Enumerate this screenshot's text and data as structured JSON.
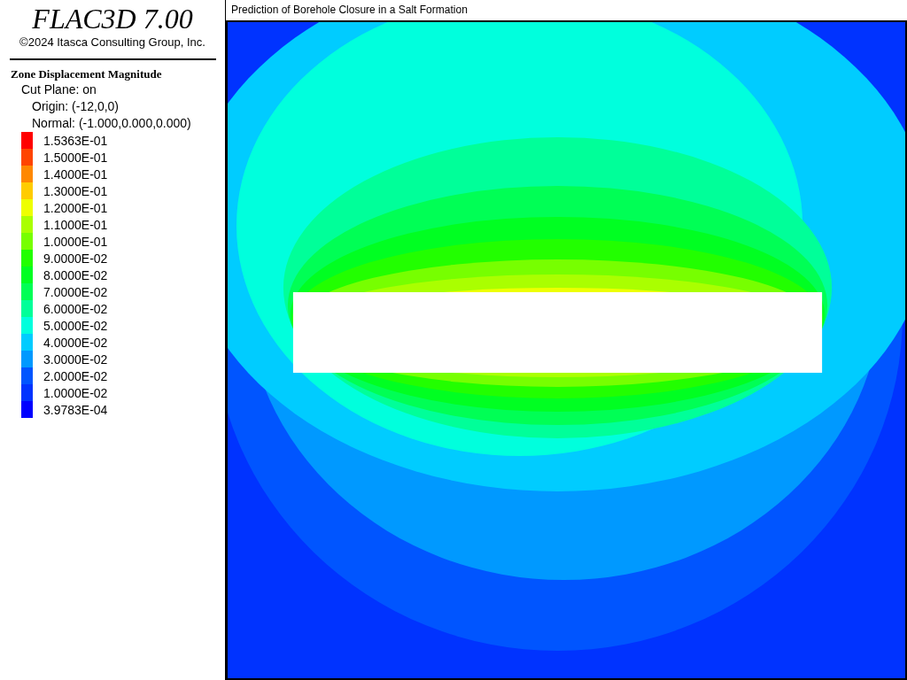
{
  "header": {
    "product": "FLAC3D 7.00",
    "copyright": "©2024 Itasca Consulting Group, Inc."
  },
  "legend": {
    "title": "Zone Displacement Magnitude",
    "lines": [
      "Cut Plane: on",
      "Origin: (-12,0,0)",
      "Normal: (-1.000,0.000,0.000)"
    ],
    "items": [
      {
        "label": "1.5363E-01",
        "color": "#ff0000"
      },
      {
        "label": "1.5000E-01",
        "color": "#ff4400"
      },
      {
        "label": "1.4000E-01",
        "color": "#ff8800"
      },
      {
        "label": "1.3000E-01",
        "color": "#ffcc00"
      },
      {
        "label": "1.2000E-01",
        "color": "#eeff00"
      },
      {
        "label": "1.1000E-01",
        "color": "#aaff00"
      },
      {
        "label": "1.0000E-01",
        "color": "#77ff00"
      },
      {
        "label": "9.0000E-02",
        "color": "#22ff00"
      },
      {
        "label": "8.0000E-02",
        "color": "#00ff22"
      },
      {
        "label": "7.0000E-02",
        "color": "#00ff55"
      },
      {
        "label": "6.0000E-02",
        "color": "#00ff99"
      },
      {
        "label": "5.0000E-02",
        "color": "#00ffdd"
      },
      {
        "label": "4.0000E-02",
        "color": "#00ccff"
      },
      {
        "label": "3.0000E-02",
        "color": "#0099ff"
      },
      {
        "label": "2.0000E-02",
        "color": "#0055ff"
      },
      {
        "label": "1.0000E-02",
        "color": "#0033ff"
      },
      {
        "label": "3.9783E-04",
        "color": "#0000ff"
      }
    ]
  },
  "plot": {
    "title": "Prediction of Borehole Closure in a Salt Formation"
  }
}
